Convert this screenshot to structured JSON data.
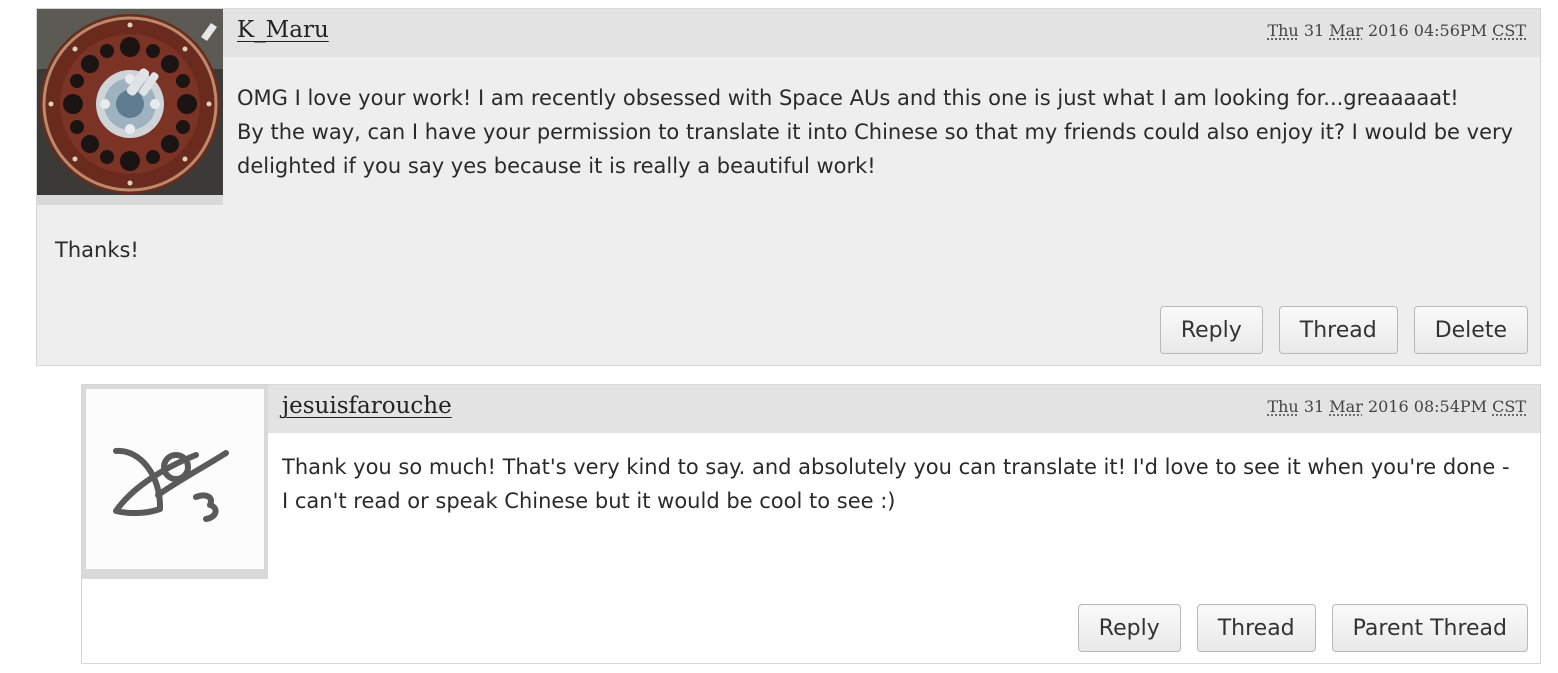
{
  "comments": [
    {
      "username": "K_Maru",
      "date": {
        "day": "Thu",
        "date": "31",
        "month": "Mar",
        "year": "2016",
        "time": "04:56PM",
        "tz": "CST"
      },
      "avatar_icon": "reel-photo-avatar",
      "paragraphs": [
        "OMG I love your work! I am recently obsessed with Space AUs and this one is just what I am looking for...greaaaaat!",
        "By the way, can I have your permission to translate it into Chinese so that my friends could also enjoy it? I would be very delighted if you say yes because it is really a beautiful work!"
      ],
      "closing": "Thanks!",
      "buttons": [
        "Reply",
        "Thread",
        "Delete"
      ]
    },
    {
      "username": "jesuisfarouche",
      "date": {
        "day": "Thu",
        "date": "31",
        "month": "Mar",
        "year": "2016",
        "time": "08:54PM",
        "tz": "CST"
      },
      "avatar_icon": "ao3-logo-avatar",
      "paragraphs": [
        "Thank you so much! That's very kind to say. and absolutely you can translate it! I'd love to see it when you're done - I can't read or speak Chinese but it would be cool to see :)"
      ],
      "buttons": [
        "Reply",
        "Thread",
        "Parent Thread"
      ]
    }
  ],
  "colors": {
    "comment_bg": "#eeeeee",
    "reply_bg": "#ffffff",
    "header_bar": "#e3e3e3"
  }
}
